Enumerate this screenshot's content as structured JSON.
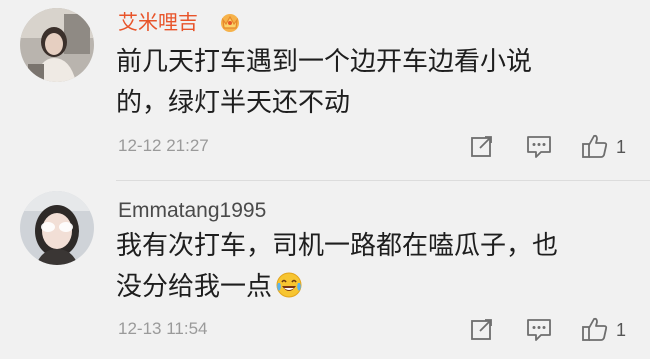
{
  "comments": [
    {
      "username": "艾米哩吉",
      "badge_icon": "vip-crown-icon",
      "text_line1": "前几天打车遇到一个边开车边看小说",
      "text_line2": "的，绿灯半天还不动",
      "timestamp": "12-12 21:27",
      "like_count": "1",
      "name_color": "#e8542a"
    },
    {
      "username": "Emmatang1995",
      "text_line1": "我有次打车，司机一路都在嗑瓜子，也",
      "text_line2": "没分给我一点",
      "trailing_emoji": "laugh-cry-emoji",
      "timestamp": "12-13 11:54",
      "like_count": "1",
      "name_color": "#4a4a4a"
    }
  ],
  "actions": {
    "share_icon": "share-icon",
    "comment_icon": "comment-icon",
    "like_icon": "thumbs-up-icon"
  }
}
